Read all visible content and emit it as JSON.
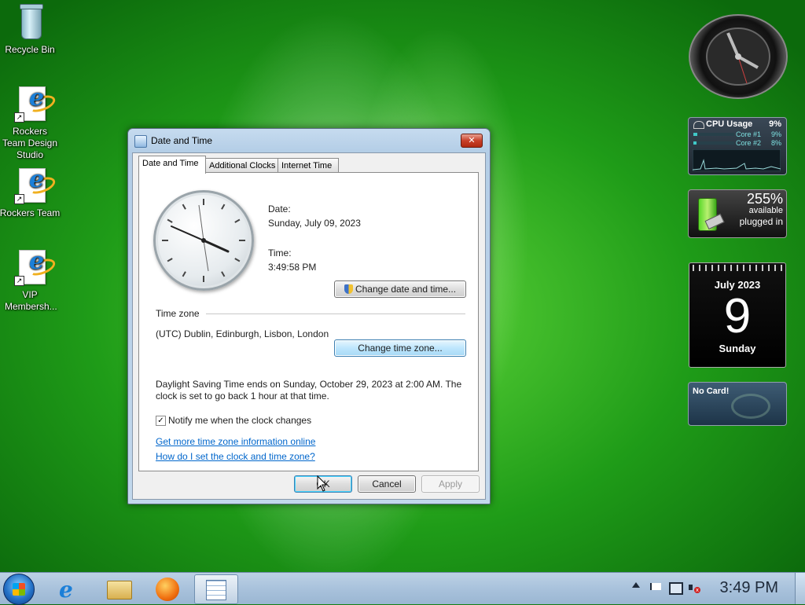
{
  "desktop": {
    "icons": [
      {
        "label": "Recycle Bin"
      },
      {
        "label": "Rockers Team Design Studio"
      },
      {
        "label": "Rockers Team"
      },
      {
        "label": "VIP Membersh..."
      }
    ]
  },
  "window": {
    "title": "Date and Time",
    "close_glyph": "✕",
    "tabs": [
      "Date and Time",
      "Additional Clocks",
      "Internet Time"
    ],
    "date_label": "Date:",
    "date_value": "Sunday, July 09, 2023",
    "time_label": "Time:",
    "time_value": "3:49:58 PM",
    "change_datetime_button": "Change date and time...",
    "timezone_heading": "Time zone",
    "timezone_value": "(UTC) Dublin, Edinburgh, Lisbon, London",
    "change_timezone_button": "Change time zone...",
    "dst_line1": "Daylight Saving Time ends on Sunday, October 29, 2023 at 2:00 AM. The",
    "dst_line2": "clock is set to go back 1 hour at that time.",
    "notify_label": "Notify me when the clock changes",
    "notify_checked": true,
    "link_more_info": "Get more time zone information online",
    "link_how_to": "How do I set the clock and time zone?",
    "ok_button": "OK",
    "cancel_button": "Cancel",
    "apply_button": "Apply"
  },
  "gadgets": {
    "cpu": {
      "title": "CPU Usage",
      "total": "9%",
      "core1_label": "Core #1",
      "core1_value": "9%",
      "core2_label": "Core #2",
      "core2_value": "8%"
    },
    "battery": {
      "percent": "255%",
      "status1": "available",
      "status2": "plugged in"
    },
    "calendar": {
      "month_year": "July 2023",
      "day": "9",
      "weekday": "Sunday"
    },
    "card": {
      "text": "No Card!"
    }
  },
  "taskbar": {
    "time": "3:49 PM"
  }
}
